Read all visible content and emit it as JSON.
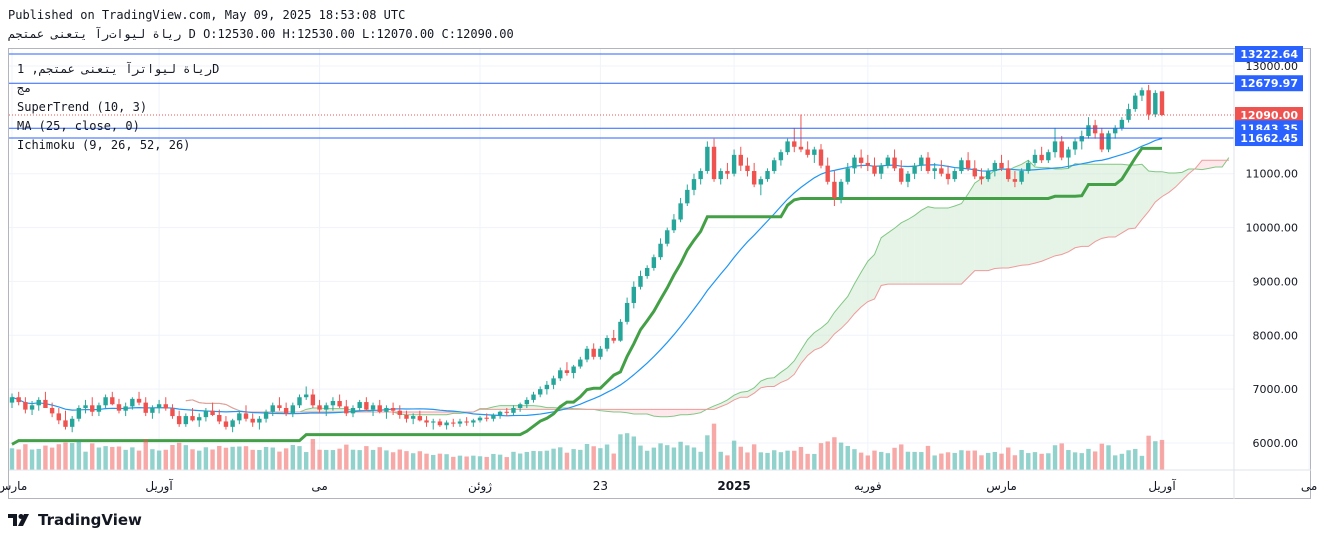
{
  "header": {
    "published": "Published on TradingView.com, May 09, 2025 18:53:08 UTC",
    "ohlc": "رياة ليوات‌رآ يتعنى عمتجم D O:12530.00 H:12530.00 L:12070.00 C:12090.00"
  },
  "legend": {
    "symbol": "رياة ليواترآ يتعنى عمتجم, 1D",
    "sub": "مج",
    "indicators": [
      "SuperTrend (10, 3)",
      "MA (25, close, 0)",
      "Ichimoku (9, 26, 52, 26)"
    ]
  },
  "logo": {
    "text": "TradingView"
  },
  "colors": {
    "up": "#26a69a",
    "down": "#ef5350",
    "supertrend_up": "#43a047",
    "supertrend_down": "#a04848",
    "ma": "#2196f3",
    "cloud_up": "#c8e6c9",
    "cloud_down": "#ffcdd2",
    "hline": "#2962ff"
  },
  "chart_data": {
    "type": "candlestick",
    "y_axis": {
      "ticks": [
        13000,
        11000,
        10000,
        9000,
        8000,
        7000,
        6000
      ],
      "tick_labels": [
        "13000.00",
        "11000.00",
        "10000.00",
        "9000.00",
        "8000.00",
        "7000.00",
        "6000.00"
      ],
      "range": [
        5480,
        13300
      ]
    },
    "price_tags": [
      {
        "value": 13222.64,
        "label": "13222.64",
        "color": "#2962ff"
      },
      {
        "value": 12679.97,
        "label": "12679.97",
        "color": "#2962ff"
      },
      {
        "value": 12090.0,
        "label": "12090.00",
        "color": "#ef5350"
      },
      {
        "value": 11843.35,
        "label": "11843.35",
        "color": "#2962ff"
      },
      {
        "value": 11662.45,
        "label": "11662.45",
        "color": "#2962ff"
      }
    ],
    "x_ticks": [
      {
        "bar": 0,
        "label": "مارس"
      },
      {
        "bar": 22,
        "label": "آوریل"
      },
      {
        "bar": 46,
        "label": "می"
      },
      {
        "bar": 70,
        "label": "ژوئن"
      },
      {
        "bar": 88,
        "label": "23"
      },
      {
        "bar": 108,
        "label": "2025",
        "bold": true
      },
      {
        "bar": 128,
        "label": "فوریه"
      },
      {
        "bar": 148,
        "label": "مارس"
      },
      {
        "bar": 172,
        "label": "آوریل"
      },
      {
        "bar": 194,
        "label": "می"
      }
    ],
    "candles": [
      [
        6750,
        6920,
        6650,
        6850
      ],
      [
        6850,
        6950,
        6700,
        6760
      ],
      [
        6760,
        6850,
        6550,
        6620
      ],
      [
        6620,
        6780,
        6520,
        6700
      ],
      [
        6700,
        6850,
        6600,
        6800
      ],
      [
        6800,
        6950,
        6700,
        6650
      ],
      [
        6650,
        6750,
        6480,
        6550
      ],
      [
        6550,
        6650,
        6350,
        6420
      ],
      [
        6420,
        6600,
        6250,
        6300
      ],
      [
        6300,
        6500,
        6200,
        6450
      ],
      [
        6450,
        6700,
        6400,
        6650
      ],
      [
        6650,
        6800,
        6550,
        6700
      ],
      [
        6700,
        6850,
        6500,
        6580
      ],
      [
        6580,
        6750,
        6500,
        6700
      ],
      [
        6700,
        6900,
        6650,
        6850
      ],
      [
        6850,
        6950,
        6700,
        6720
      ],
      [
        6720,
        6820,
        6550,
        6600
      ],
      [
        6600,
        6750,
        6500,
        6680
      ],
      [
        6680,
        6850,
        6620,
        6820
      ],
      [
        6820,
        6950,
        6700,
        6750
      ],
      [
        6750,
        6850,
        6500,
        6560
      ],
      [
        6560,
        6700,
        6450,
        6650
      ],
      [
        6650,
        6800,
        6550,
        6720
      ],
      [
        6720,
        6850,
        6600,
        6640
      ],
      [
        6640,
        6720,
        6450,
        6500
      ],
      [
        6500,
        6600,
        6300,
        6350
      ],
      [
        6350,
        6550,
        6300,
        6500
      ],
      [
        6500,
        6650,
        6400,
        6420
      ],
      [
        6420,
        6550,
        6300,
        6480
      ],
      [
        6480,
        6650,
        6400,
        6600
      ],
      [
        6600,
        6750,
        6500,
        6520
      ],
      [
        6520,
        6620,
        6350,
        6400
      ],
      [
        6400,
        6500,
        6250,
        6300
      ],
      [
        6300,
        6450,
        6200,
        6420
      ],
      [
        6420,
        6600,
        6350,
        6550
      ],
      [
        6550,
        6700,
        6400,
        6450
      ],
      [
        6450,
        6550,
        6300,
        6380
      ],
      [
        6380,
        6500,
        6250,
        6450
      ],
      [
        6450,
        6620,
        6380,
        6580
      ],
      [
        6580,
        6750,
        6500,
        6700
      ],
      [
        6700,
        6850,
        6600,
        6650
      ],
      [
        6650,
        6750,
        6500,
        6550
      ],
      [
        6550,
        6750,
        6480,
        6700
      ],
      [
        6700,
        6900,
        6650,
        6850
      ],
      [
        6850,
        7050,
        6800,
        6900
      ],
      [
        6900,
        7000,
        6650,
        6700
      ],
      [
        6700,
        6800,
        6550,
        6620
      ],
      [
        6620,
        6750,
        6500,
        6700
      ],
      [
        6700,
        6850,
        6600,
        6780
      ],
      [
        6780,
        6900,
        6650,
        6680
      ],
      [
        6680,
        6800,
        6500,
        6550
      ],
      [
        6550,
        6700,
        6480,
        6650
      ],
      [
        6650,
        6800,
        6600,
        6760
      ],
      [
        6760,
        6850,
        6600,
        6620
      ],
      [
        6620,
        6750,
        6500,
        6700
      ],
      [
        6700,
        6800,
        6550,
        6580
      ],
      [
        6580,
        6700,
        6450,
        6650
      ],
      [
        6650,
        6750,
        6520,
        6600
      ],
      [
        6600,
        6700,
        6450,
        6520
      ],
      [
        6520,
        6600,
        6380,
        6450
      ],
      [
        6450,
        6550,
        6350,
        6500
      ],
      [
        6500,
        6600,
        6400,
        6420
      ],
      [
        6420,
        6500,
        6300,
        6380
      ],
      [
        6380,
        6450,
        6250,
        6400
      ],
      [
        6400,
        6450,
        6300,
        6330
      ],
      [
        6330,
        6420,
        6250,
        6380
      ],
      [
        6380,
        6450,
        6300,
        6360
      ],
      [
        6360,
        6450,
        6300,
        6400
      ],
      [
        6400,
        6480,
        6320,
        6380
      ],
      [
        6380,
        6450,
        6300,
        6420
      ],
      [
        6420,
        6500,
        6380,
        6470
      ],
      [
        6470,
        6550,
        6400,
        6450
      ],
      [
        6450,
        6550,
        6400,
        6520
      ],
      [
        6520,
        6600,
        6450,
        6580
      ],
      [
        6580,
        6650,
        6500,
        6560
      ],
      [
        6560,
        6700,
        6520,
        6650
      ],
      [
        6650,
        6750,
        6580,
        6720
      ],
      [
        6720,
        6850,
        6650,
        6800
      ],
      [
        6800,
        6950,
        6750,
        6900
      ],
      [
        6900,
        7050,
        6850,
        7000
      ],
      [
        7000,
        7150,
        6900,
        7080
      ],
      [
        7080,
        7250,
        7000,
        7200
      ],
      [
        7200,
        7400,
        7150,
        7350
      ],
      [
        7350,
        7500,
        7250,
        7300
      ],
      [
        7300,
        7450,
        7200,
        7420
      ],
      [
        7420,
        7600,
        7380,
        7550
      ],
      [
        7550,
        7800,
        7500,
        7750
      ],
      [
        7750,
        7850,
        7550,
        7600
      ],
      [
        7600,
        7800,
        7550,
        7750
      ],
      [
        7750,
        8000,
        7700,
        7950
      ],
      [
        7950,
        8100,
        7850,
        7900
      ],
      [
        7900,
        8300,
        7880,
        8250
      ],
      [
        8250,
        8700,
        8200,
        8600
      ],
      [
        8600,
        9000,
        8500,
        8900
      ],
      [
        8900,
        9200,
        8850,
        9100
      ],
      [
        9100,
        9300,
        9050,
        9250
      ],
      [
        9250,
        9500,
        9200,
        9450
      ],
      [
        9450,
        9800,
        9400,
        9700
      ],
      [
        9700,
        10000,
        9650,
        9950
      ],
      [
        9950,
        10250,
        9900,
        10150
      ],
      [
        10150,
        10550,
        10100,
        10450
      ],
      [
        10450,
        10800,
        10400,
        10700
      ],
      [
        10700,
        11000,
        10600,
        10900
      ],
      [
        10900,
        11100,
        10800,
        11050
      ],
      [
        11050,
        11600,
        11000,
        11500
      ],
      [
        11500,
        11650,
        10850,
        10900
      ],
      [
        10900,
        11100,
        10800,
        11050
      ],
      [
        11050,
        11200,
        10900,
        11000
      ],
      [
        11000,
        11450,
        10950,
        11350
      ],
      [
        11350,
        11500,
        11050,
        11150
      ],
      [
        11150,
        11300,
        10950,
        11050
      ],
      [
        11050,
        11200,
        10750,
        10800
      ],
      [
        10800,
        10950,
        10600,
        10900
      ],
      [
        10900,
        11100,
        10850,
        11050
      ],
      [
        11050,
        11300,
        11000,
        11250
      ],
      [
        11250,
        11450,
        11150,
        11400
      ],
      [
        11400,
        11650,
        11350,
        11600
      ],
      [
        11600,
        11850,
        11400,
        11500
      ],
      [
        11500,
        12100,
        11400,
        11450
      ],
      [
        11450,
        11600,
        11300,
        11350
      ],
      [
        11350,
        11500,
        11200,
        11450
      ],
      [
        11450,
        11550,
        11100,
        11150
      ],
      [
        11150,
        11300,
        10800,
        10850
      ],
      [
        10850,
        11050,
        10400,
        10550
      ],
      [
        10550,
        10900,
        10450,
        10850
      ],
      [
        10850,
        11200,
        10800,
        11100
      ],
      [
        11100,
        11350,
        11000,
        11300
      ],
      [
        11300,
        11450,
        11100,
        11200
      ],
      [
        11200,
        11350,
        11050,
        11150
      ],
      [
        11150,
        11300,
        10950,
        11000
      ],
      [
        11000,
        11200,
        10900,
        11150
      ],
      [
        11150,
        11350,
        11100,
        11300
      ],
      [
        11300,
        11450,
        11050,
        11100
      ],
      [
        11100,
        11250,
        10800,
        10850
      ],
      [
        10850,
        11050,
        10750,
        11000
      ],
      [
        11000,
        11200,
        10900,
        11150
      ],
      [
        11150,
        11350,
        11050,
        11300
      ],
      [
        11300,
        11400,
        11000,
        11050
      ],
      [
        11050,
        11200,
        10900,
        11100
      ],
      [
        11100,
        11250,
        10950,
        11000
      ],
      [
        11000,
        11150,
        10800,
        10900
      ],
      [
        10900,
        11100,
        10850,
        11050
      ],
      [
        11050,
        11300,
        11000,
        11250
      ],
      [
        11250,
        11400,
        11050,
        11100
      ],
      [
        11100,
        11250,
        10900,
        10950
      ],
      [
        10950,
        11100,
        10800,
        10900
      ],
      [
        10900,
        11100,
        10850,
        11050
      ],
      [
        11050,
        11250,
        10950,
        11200
      ],
      [
        11200,
        11350,
        11050,
        11100
      ],
      [
        11100,
        11250,
        10850,
        10900
      ],
      [
        10900,
        11050,
        10750,
        10850
      ],
      [
        10850,
        11100,
        10800,
        11050
      ],
      [
        11050,
        11250,
        11000,
        11200
      ],
      [
        11200,
        11450,
        11150,
        11350
      ],
      [
        11350,
        11500,
        11200,
        11250
      ],
      [
        11250,
        11450,
        11200,
        11400
      ],
      [
        11400,
        11850,
        11300,
        11600
      ],
      [
        11600,
        11700,
        11250,
        11300
      ],
      [
        11300,
        11500,
        11100,
        11450
      ],
      [
        11450,
        11650,
        11350,
        11600
      ],
      [
        11600,
        11800,
        11450,
        11700
      ],
      [
        11700,
        12050,
        11650,
        11900
      ],
      [
        11900,
        12000,
        11650,
        11750
      ],
      [
        11750,
        11850,
        11400,
        11450
      ],
      [
        11450,
        11800,
        11400,
        11750
      ],
      [
        11750,
        11900,
        11650,
        11850
      ],
      [
        11850,
        12050,
        11800,
        12000
      ],
      [
        12000,
        12300,
        11950,
        12200
      ],
      [
        12200,
        12500,
        12150,
        12450
      ],
      [
        12450,
        12600,
        12350,
        12550
      ],
      [
        12550,
        12650,
        12000,
        12100
      ],
      [
        12100,
        12550,
        12050,
        12500
      ],
      [
        12530,
        12530,
        12070,
        12090
      ]
    ],
    "volume_max": 100
  }
}
